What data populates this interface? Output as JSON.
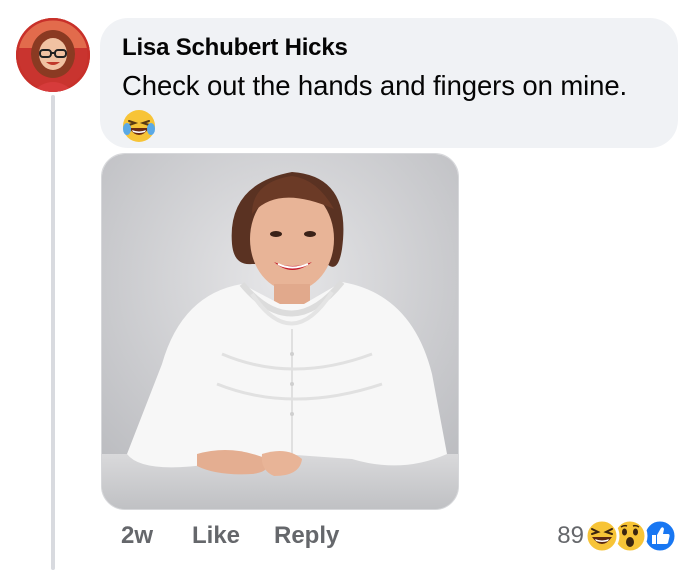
{
  "comment": {
    "author": "Lisa Schubert Hicks",
    "text": "Check out the hands and fingers on mine.",
    "inline_emoji": "laughing-tears-emoji"
  },
  "actions": {
    "time": "2w",
    "like_label": "Like",
    "reply_label": "Reply"
  },
  "reactions": {
    "count": "89",
    "icons": [
      "haha-reaction-icon",
      "wow-reaction-icon",
      "like-reaction-icon"
    ]
  },
  "colors": {
    "bubble_bg": "#f0f2f5",
    "secondary_text": "#65676b",
    "like_blue": "#1877f2",
    "emoji_yellow": "#f7c437"
  }
}
